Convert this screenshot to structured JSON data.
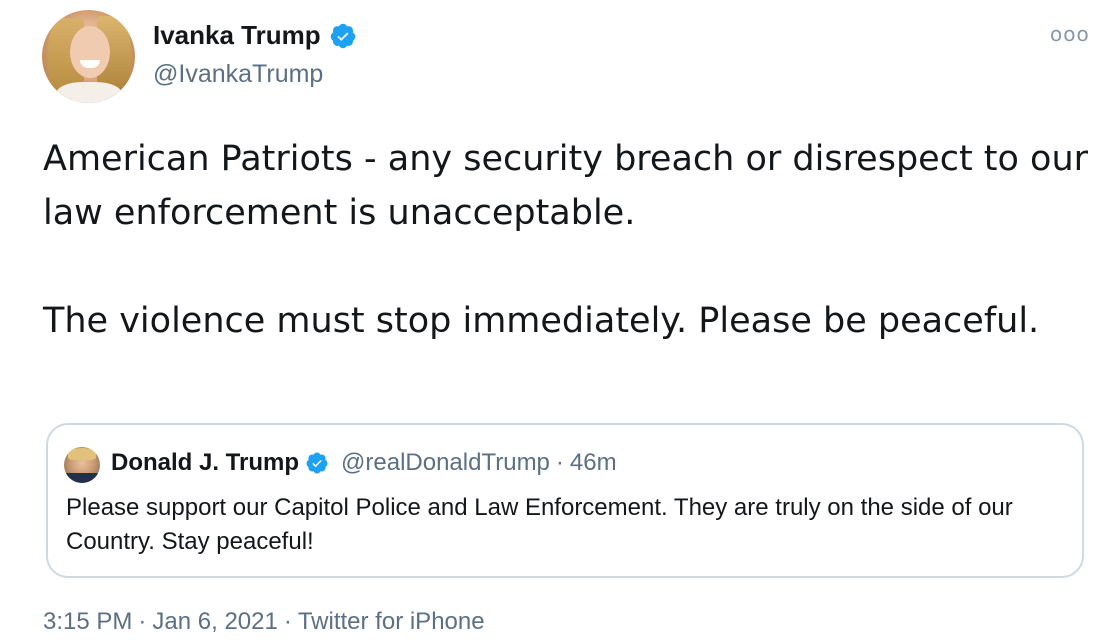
{
  "author": {
    "display_name": "Ivanka Trump",
    "handle": "@IvankaTrump",
    "verified_icon": "verified-badge-icon"
  },
  "menu_icon": "ooo",
  "tweet": {
    "text": "American Patriots - any security breach or disrespect to our law enforcement is unacceptable.\n\nThe violence must stop immediately. Please be peaceful."
  },
  "quoted_tweet": {
    "display_name": "Donald J. Trump",
    "handle": "@realDonaldTrump",
    "separator": "·",
    "time": "46m",
    "text": "Please support our Capitol Police and Law Enforcement. They are truly on the side of our Country. Stay peaceful!"
  },
  "meta": {
    "time": "3:15 PM",
    "sep1": "·",
    "date": "Jan 6, 2021",
    "sep2": "·",
    "source": "Twitter for iPhone"
  },
  "colors": {
    "verified_blue": "#1da1f2",
    "secondary_text": "#5b7083",
    "border": "#cfd9de"
  }
}
